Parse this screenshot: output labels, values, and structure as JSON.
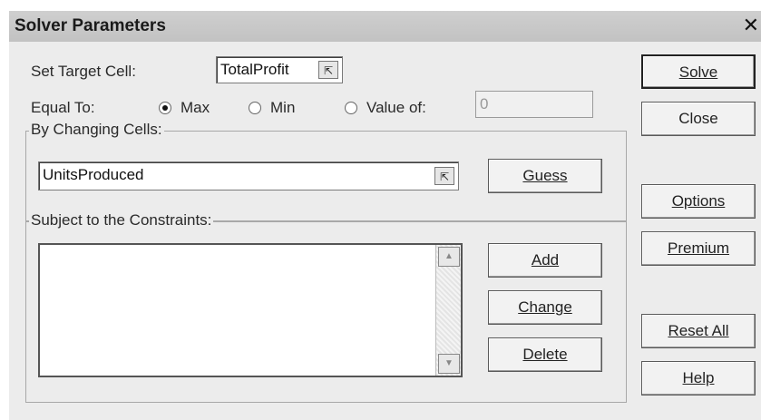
{
  "window": {
    "title": "Solver Parameters",
    "close_glyph": "✕"
  },
  "target": {
    "label": "Set Target Cell:",
    "value": "TotalProfit"
  },
  "equal_to": {
    "label": "Equal To:",
    "options": [
      "Max",
      "Min",
      "Value of:"
    ],
    "selected": "Max",
    "value_of": "0"
  },
  "changing": {
    "group_label": "By Changing Cells:",
    "value": "UnitsProduced"
  },
  "constraints": {
    "group_label": "Subject to the Constraints:",
    "items": []
  },
  "buttons": {
    "solve": "Solve",
    "close": "Close",
    "options": "Options",
    "premium": "Premium",
    "reset_all": "Reset All",
    "help": "Help",
    "guess": "Guess",
    "add": "Add",
    "change": "Change",
    "delete": "Delete"
  },
  "icons": {
    "refedit": "collapse-dialog-icon",
    "scroll_up": "scroll-up-icon",
    "scroll_down": "scroll-down-icon"
  }
}
